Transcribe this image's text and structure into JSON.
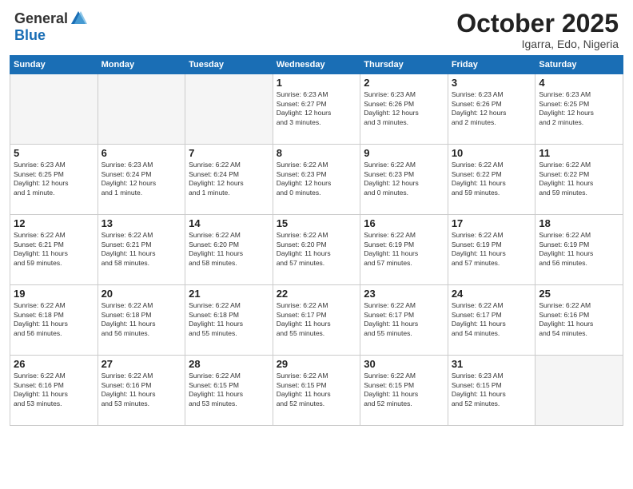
{
  "header": {
    "logo_general": "General",
    "logo_blue": "Blue",
    "month_title": "October 2025",
    "location": "Igarra, Edo, Nigeria"
  },
  "days_of_week": [
    "Sunday",
    "Monday",
    "Tuesday",
    "Wednesday",
    "Thursday",
    "Friday",
    "Saturday"
  ],
  "weeks": [
    [
      {
        "num": "",
        "info": ""
      },
      {
        "num": "",
        "info": ""
      },
      {
        "num": "",
        "info": ""
      },
      {
        "num": "1",
        "info": "Sunrise: 6:23 AM\nSunset: 6:27 PM\nDaylight: 12 hours\nand 3 minutes."
      },
      {
        "num": "2",
        "info": "Sunrise: 6:23 AM\nSunset: 6:26 PM\nDaylight: 12 hours\nand 3 minutes."
      },
      {
        "num": "3",
        "info": "Sunrise: 6:23 AM\nSunset: 6:26 PM\nDaylight: 12 hours\nand 2 minutes."
      },
      {
        "num": "4",
        "info": "Sunrise: 6:23 AM\nSunset: 6:25 PM\nDaylight: 12 hours\nand 2 minutes."
      }
    ],
    [
      {
        "num": "5",
        "info": "Sunrise: 6:23 AM\nSunset: 6:25 PM\nDaylight: 12 hours\nand 1 minute."
      },
      {
        "num": "6",
        "info": "Sunrise: 6:23 AM\nSunset: 6:24 PM\nDaylight: 12 hours\nand 1 minute."
      },
      {
        "num": "7",
        "info": "Sunrise: 6:22 AM\nSunset: 6:24 PM\nDaylight: 12 hours\nand 1 minute."
      },
      {
        "num": "8",
        "info": "Sunrise: 6:22 AM\nSunset: 6:23 PM\nDaylight: 12 hours\nand 0 minutes."
      },
      {
        "num": "9",
        "info": "Sunrise: 6:22 AM\nSunset: 6:23 PM\nDaylight: 12 hours\nand 0 minutes."
      },
      {
        "num": "10",
        "info": "Sunrise: 6:22 AM\nSunset: 6:22 PM\nDaylight: 11 hours\nand 59 minutes."
      },
      {
        "num": "11",
        "info": "Sunrise: 6:22 AM\nSunset: 6:22 PM\nDaylight: 11 hours\nand 59 minutes."
      }
    ],
    [
      {
        "num": "12",
        "info": "Sunrise: 6:22 AM\nSunset: 6:21 PM\nDaylight: 11 hours\nand 59 minutes."
      },
      {
        "num": "13",
        "info": "Sunrise: 6:22 AM\nSunset: 6:21 PM\nDaylight: 11 hours\nand 58 minutes."
      },
      {
        "num": "14",
        "info": "Sunrise: 6:22 AM\nSunset: 6:20 PM\nDaylight: 11 hours\nand 58 minutes."
      },
      {
        "num": "15",
        "info": "Sunrise: 6:22 AM\nSunset: 6:20 PM\nDaylight: 11 hours\nand 57 minutes."
      },
      {
        "num": "16",
        "info": "Sunrise: 6:22 AM\nSunset: 6:19 PM\nDaylight: 11 hours\nand 57 minutes."
      },
      {
        "num": "17",
        "info": "Sunrise: 6:22 AM\nSunset: 6:19 PM\nDaylight: 11 hours\nand 57 minutes."
      },
      {
        "num": "18",
        "info": "Sunrise: 6:22 AM\nSunset: 6:19 PM\nDaylight: 11 hours\nand 56 minutes."
      }
    ],
    [
      {
        "num": "19",
        "info": "Sunrise: 6:22 AM\nSunset: 6:18 PM\nDaylight: 11 hours\nand 56 minutes."
      },
      {
        "num": "20",
        "info": "Sunrise: 6:22 AM\nSunset: 6:18 PM\nDaylight: 11 hours\nand 56 minutes."
      },
      {
        "num": "21",
        "info": "Sunrise: 6:22 AM\nSunset: 6:18 PM\nDaylight: 11 hours\nand 55 minutes."
      },
      {
        "num": "22",
        "info": "Sunrise: 6:22 AM\nSunset: 6:17 PM\nDaylight: 11 hours\nand 55 minutes."
      },
      {
        "num": "23",
        "info": "Sunrise: 6:22 AM\nSunset: 6:17 PM\nDaylight: 11 hours\nand 55 minutes."
      },
      {
        "num": "24",
        "info": "Sunrise: 6:22 AM\nSunset: 6:17 PM\nDaylight: 11 hours\nand 54 minutes."
      },
      {
        "num": "25",
        "info": "Sunrise: 6:22 AM\nSunset: 6:16 PM\nDaylight: 11 hours\nand 54 minutes."
      }
    ],
    [
      {
        "num": "26",
        "info": "Sunrise: 6:22 AM\nSunset: 6:16 PM\nDaylight: 11 hours\nand 53 minutes."
      },
      {
        "num": "27",
        "info": "Sunrise: 6:22 AM\nSunset: 6:16 PM\nDaylight: 11 hours\nand 53 minutes."
      },
      {
        "num": "28",
        "info": "Sunrise: 6:22 AM\nSunset: 6:15 PM\nDaylight: 11 hours\nand 53 minutes."
      },
      {
        "num": "29",
        "info": "Sunrise: 6:22 AM\nSunset: 6:15 PM\nDaylight: 11 hours\nand 52 minutes."
      },
      {
        "num": "30",
        "info": "Sunrise: 6:22 AM\nSunset: 6:15 PM\nDaylight: 11 hours\nand 52 minutes."
      },
      {
        "num": "31",
        "info": "Sunrise: 6:23 AM\nSunset: 6:15 PM\nDaylight: 11 hours\nand 52 minutes."
      },
      {
        "num": "",
        "info": ""
      }
    ]
  ]
}
